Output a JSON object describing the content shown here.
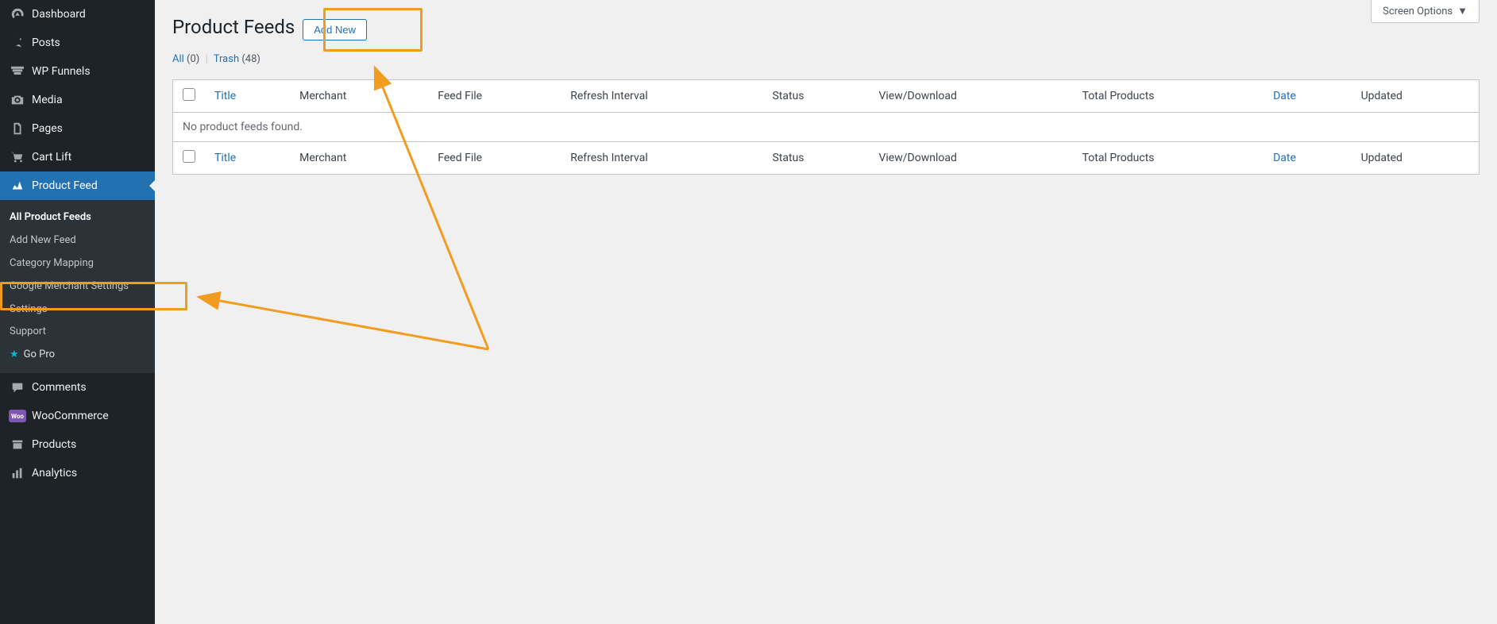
{
  "sidebar": {
    "dashboard": "Dashboard",
    "posts": "Posts",
    "wpfunnels": "WP Funnels",
    "media": "Media",
    "pages": "Pages",
    "cartlift": "Cart Lift",
    "productfeed": "Product Feed",
    "comments": "Comments",
    "woocommerce": "WooCommerce",
    "products": "Products",
    "analytics": "Analytics",
    "submenu": {
      "all_feeds": "All Product Feeds",
      "add_new": "Add New Feed",
      "category_mapping": "Category Mapping",
      "google_merchant": "Google Merchant Settings",
      "settings": "Settings",
      "support": "Support",
      "gopro": "Go Pro"
    }
  },
  "header": {
    "title": "Product Feeds",
    "add_new_label": "Add New",
    "screen_options": "Screen Options"
  },
  "filters": {
    "all_label": "All",
    "all_count": "(0)",
    "trash_label": "Trash",
    "trash_count": "(48)"
  },
  "table": {
    "columns": {
      "title": "Title",
      "merchant": "Merchant",
      "feedfile": "Feed File",
      "refresh": "Refresh Interval",
      "status": "Status",
      "viewdl": "View/Download",
      "total": "Total Products",
      "date": "Date",
      "updated": "Updated"
    },
    "empty_message": "No product feeds found."
  }
}
